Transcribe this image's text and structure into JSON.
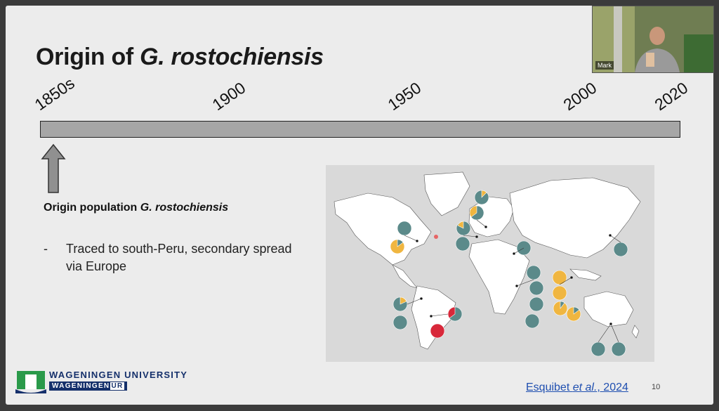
{
  "slide": {
    "title_prefix": "Origin of ",
    "title_italic": "G. rostochiensis",
    "timeline_labels": [
      "1850s",
      "1900",
      "1950",
      "2000",
      "2020"
    ],
    "origin_heading_prefix": "Origin population ",
    "origin_heading_italic": "G. rostochiensis",
    "bullet_dash": "-",
    "bullet_text": "Traced to south-Peru, secondary spread via Europe",
    "logo_university": "WAGENINGEN UNIVERSITY",
    "logo_sub": "WAGENINGEN",
    "logo_ur": "UR",
    "citation_author": "Esquibet ",
    "citation_etal": "et al.",
    "citation_year": ", 2024",
    "page_number": "10"
  },
  "video": {
    "participant_name": "Mark"
  },
  "colors": {
    "teal": "#5b8a8a",
    "yellow": "#f0b640",
    "red": "#d8283a",
    "brand_blue": "#15306b"
  }
}
